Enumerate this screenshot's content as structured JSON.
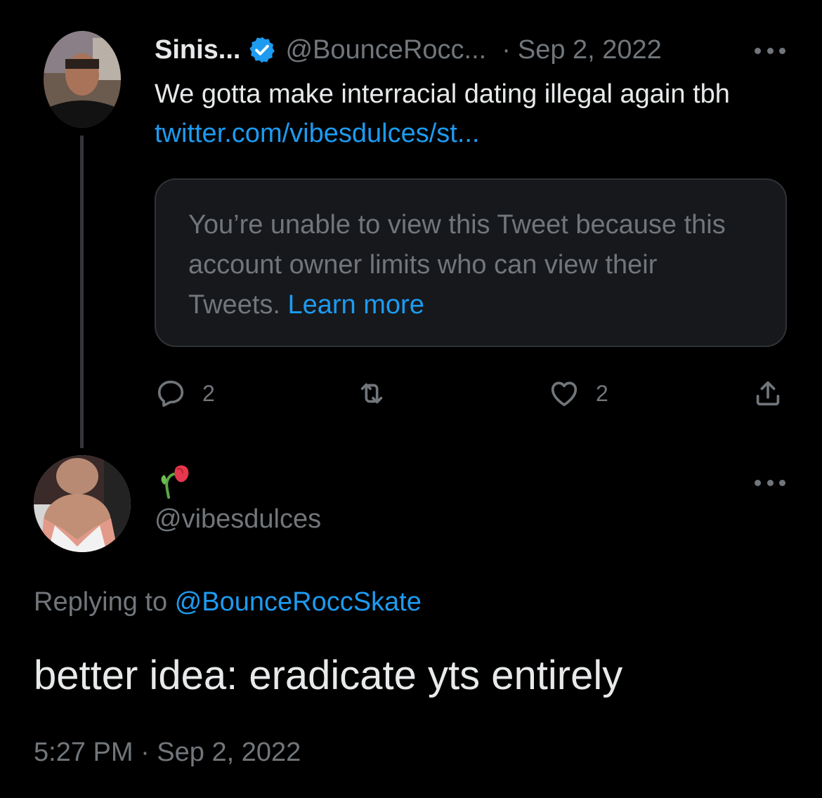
{
  "parent_tweet": {
    "display_name": "Sinis...",
    "handle": "@BounceRocc...",
    "separator": "·",
    "date": "Sep 2, 2022",
    "text_before": "We gotta make interracial dating illegal again tbh ",
    "link_text": "twitter.com/vibesdulces/st...",
    "quote_notice": "You’re unable to view this Tweet because this account owner limits who can view their Tweets. ",
    "learn_more": "Learn more",
    "replies": "2",
    "likes": "2",
    "icons": [
      "verified-badge-icon",
      "reply-icon",
      "retweet-icon",
      "like-icon",
      "share-icon",
      "more-icon"
    ]
  },
  "reply_tweet": {
    "handle": "@vibesdulces",
    "replying_prefix": "Replying to ",
    "replying_handle": "@BounceRoccSkate",
    "text": "better idea: eradicate yts entirely",
    "timestamp": "5:27 PM · Sep 2, 2022",
    "icons": [
      "wilted-flower-icon",
      "more-icon"
    ]
  },
  "colors": {
    "background": "#000000",
    "primary_text": "#e7e9ea",
    "secondary_text": "#71767b",
    "link": "#1d9bf0",
    "verified": "#1d9bf0"
  }
}
